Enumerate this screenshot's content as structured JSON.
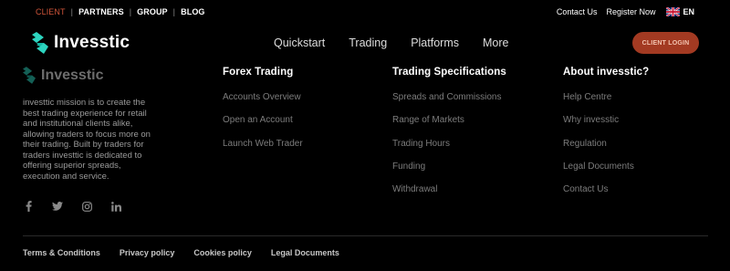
{
  "topnav": {
    "items": [
      "CLIENT",
      "PARTNERS",
      "GROUP",
      "BLOG"
    ],
    "active_color": "#d0553a"
  },
  "topright": {
    "contact": "Contact Us",
    "register": "Register Now",
    "lang": "EN",
    "flag_icon": "uk-flag-icon"
  },
  "brand": {
    "name": "Invesstic",
    "accent": "#2dd4bf"
  },
  "mainnav": {
    "items": [
      "Quickstart",
      "Trading",
      "Platforms",
      "More"
    ],
    "cta": "CLIENT LOGIN",
    "cta_color": "#a33a22"
  },
  "footer": {
    "brand_name": "Invesstic",
    "mission": "investtic mission is to create the best trading experience for retail and institutional clients alike, allowing traders to focus more on their trading. Built by traders for traders investtic is dedicated to offering superior spreads, execution and service.",
    "social": [
      "facebook-icon",
      "twitter-icon",
      "instagram-icon",
      "linkedin-icon"
    ],
    "columns": [
      {
        "title": "Forex Trading",
        "links": [
          "Accounts Overview",
          "Open an Account",
          "Launch Web Trader"
        ]
      },
      {
        "title": "Trading Specifications",
        "links": [
          "Spreads and Commissions",
          "Range of Markets",
          "Trading Hours",
          "Funding",
          "Withdrawal"
        ]
      },
      {
        "title": "About invesstic?",
        "links": [
          "Help Centre",
          "Why invesstic",
          "Regulation",
          "Legal Documents",
          "Contact Us"
        ]
      }
    ],
    "bottom_links": [
      "Terms & Conditions",
      "Privacy policy",
      "Cookies policy",
      "Legal Documents"
    ]
  }
}
